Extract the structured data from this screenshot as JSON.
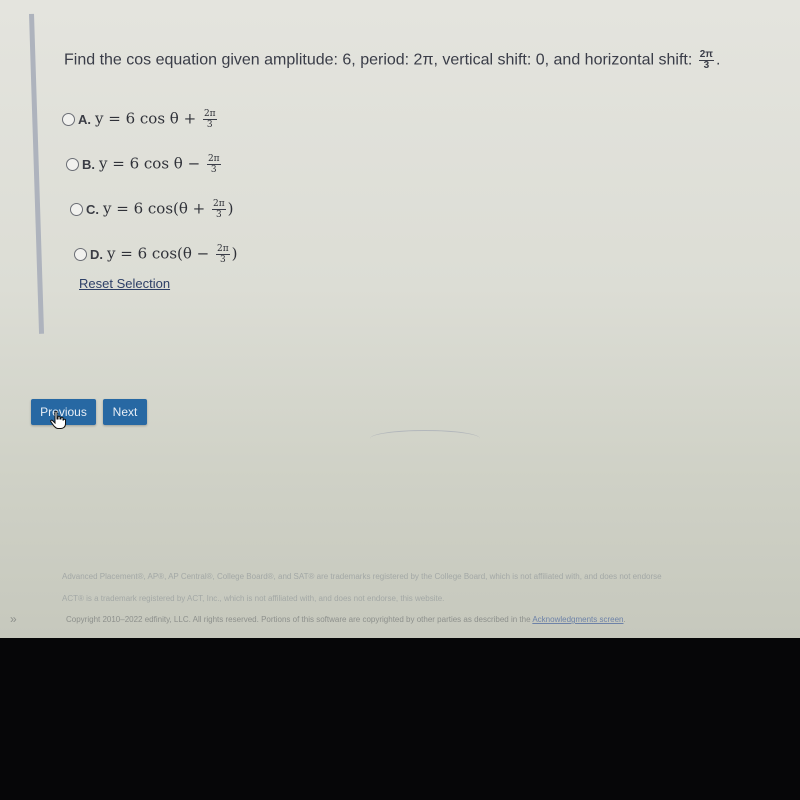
{
  "question": {
    "prefix": "Find the cos equation given amplitude: 6, period: 2π, vertical shift: 0, and horizontal shift:",
    "frac_num": "2π",
    "frac_den": "3",
    "suffix": "."
  },
  "options": [
    {
      "letter": "A.",
      "eq_pre": "y = 6 cos θ + ",
      "frac_num": "2π",
      "frac_den": "3",
      "eq_post": "",
      "selected": false
    },
    {
      "letter": "B.",
      "eq_pre": "y = 6 cos θ − ",
      "frac_num": "2π",
      "frac_den": "3",
      "eq_post": "",
      "selected": false
    },
    {
      "letter": "C.",
      "eq_pre": "y = 6 cos(θ + ",
      "frac_num": "2π",
      "frac_den": "3",
      "eq_post": ")",
      "selected": false
    },
    {
      "letter": "D.",
      "eq_pre": "y = 6 cos(θ − ",
      "frac_num": "2π",
      "frac_den": "3",
      "eq_post": ")",
      "selected": false
    }
  ],
  "reset_label": "Reset Selection",
  "nav": {
    "previous_label": "Previous",
    "next_label": "Next"
  },
  "footer": {
    "line1": "Advanced Placement®, AP®, AP Central®, College Board®, and SAT® are trademarks registered by the College Board, which is not affiliated with, and does not endorse",
    "line2": "ACT® is a trademark registered by ACT, Inc., which is not affiliated with, and does not endorse, this website.",
    "line3_prefix": "Copyright 2010–2022 edfinity, LLC. All rights reserved. Portions of this software are copyrighted by other parties as described in the ",
    "line3_link": "Acknowledgments screen",
    "line3_suffix": "."
  },
  "expand_icon": "»",
  "colors": {
    "button": "#2768a3",
    "link": "#2d3f66"
  }
}
